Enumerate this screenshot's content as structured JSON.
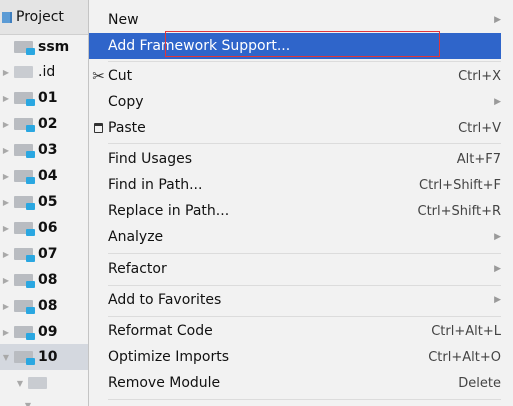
{
  "project_panel": {
    "title": "Project",
    "rows": [
      {
        "label": "ssm",
        "expanded": true,
        "kind": "module"
      },
      {
        "label": ".id",
        "expanded": false,
        "kind": "plain"
      },
      {
        "label": "01",
        "expanded": false,
        "kind": "module"
      },
      {
        "label": "02",
        "expanded": false,
        "kind": "module"
      },
      {
        "label": "03",
        "expanded": false,
        "kind": "module"
      },
      {
        "label": "04",
        "expanded": false,
        "kind": "module"
      },
      {
        "label": "05",
        "expanded": false,
        "kind": "module"
      },
      {
        "label": "06",
        "expanded": false,
        "kind": "module"
      },
      {
        "label": "07",
        "expanded": false,
        "kind": "module"
      },
      {
        "label": "08",
        "expanded": false,
        "kind": "module"
      },
      {
        "label": "08",
        "expanded": false,
        "kind": "module"
      },
      {
        "label": "09",
        "expanded": false,
        "kind": "module"
      },
      {
        "label": "10",
        "expanded": true,
        "kind": "module",
        "selected": true
      },
      {
        "label": "",
        "expanded": true,
        "kind": "plain"
      }
    ]
  },
  "context_menu": {
    "highlighted_item": "Add Framework Support...",
    "highlight_color": "#2f65ca",
    "annotation_color": "#e0363a",
    "items": [
      {
        "label": "New",
        "shortcut": "",
        "submenu": true,
        "icon": ""
      },
      {
        "label": "Add Framework Support...",
        "shortcut": "",
        "submenu": false,
        "icon": ""
      },
      {
        "label": "Cut",
        "shortcut": "Ctrl+X",
        "submenu": false,
        "icon": "scissors-icon"
      },
      {
        "label": "Copy",
        "shortcut": "",
        "submenu": true,
        "icon": ""
      },
      {
        "label": "Paste",
        "shortcut": "Ctrl+V",
        "submenu": false,
        "icon": "clipboard-icon"
      },
      {
        "label": "Find Usages",
        "shortcut": "Alt+F7",
        "submenu": false,
        "icon": ""
      },
      {
        "label": "Find in Path...",
        "shortcut": "Ctrl+Shift+F",
        "submenu": false,
        "icon": ""
      },
      {
        "label": "Replace in Path...",
        "shortcut": "Ctrl+Shift+R",
        "submenu": false,
        "icon": ""
      },
      {
        "label": "Analyze",
        "shortcut": "",
        "submenu": true,
        "icon": ""
      },
      {
        "label": "Refactor",
        "shortcut": "",
        "submenu": true,
        "icon": ""
      },
      {
        "label": "Add to Favorites",
        "shortcut": "",
        "submenu": true,
        "icon": ""
      },
      {
        "label": "Reformat Code",
        "shortcut": "Ctrl+Alt+L",
        "submenu": false,
        "icon": ""
      },
      {
        "label": "Optimize Imports",
        "shortcut": "Ctrl+Alt+O",
        "submenu": false,
        "icon": ""
      },
      {
        "label": "Remove Module",
        "shortcut": "Delete",
        "submenu": false,
        "icon": ""
      }
    ]
  }
}
